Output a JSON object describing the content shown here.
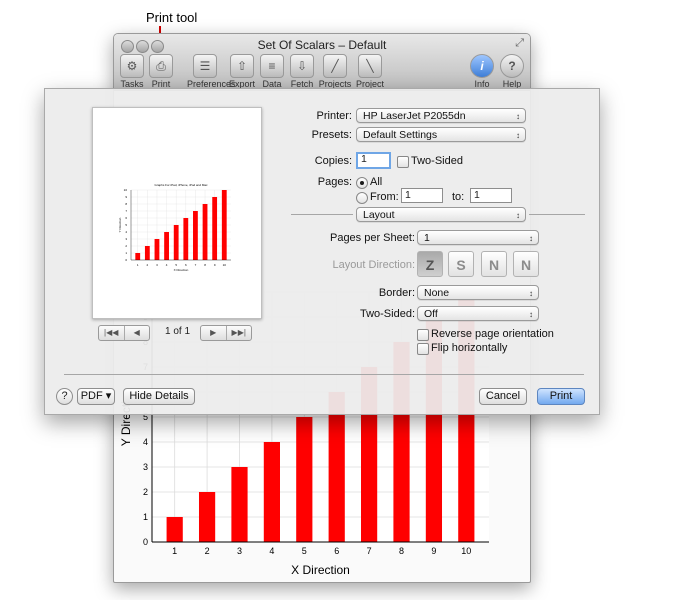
{
  "callout": {
    "label": "Print tool"
  },
  "window": {
    "title": "Set Of Scalars – Default",
    "toolbar": [
      {
        "label": "Tasks",
        "icon": "gear-icon",
        "glyph": "⚙"
      },
      {
        "label": "Print",
        "icon": "printer-icon",
        "glyph": "⎙"
      },
      {
        "label": "Preferences",
        "icon": "preferences-icon",
        "glyph": "☰"
      },
      {
        "label": "Export",
        "icon": "export-icon",
        "glyph": "⇧"
      },
      {
        "label": "Data",
        "icon": "data-icon",
        "glyph": "≡"
      },
      {
        "label": "Fetch",
        "icon": "fetch-icon",
        "glyph": "⇩"
      },
      {
        "label": "Projects",
        "icon": "projects-icon",
        "glyph": "╱"
      },
      {
        "label": "Project",
        "icon": "project-icon",
        "glyph": "╲"
      },
      {
        "label": "Info",
        "icon": "info-icon",
        "glyph": "i"
      },
      {
        "label": "Help",
        "icon": "help-icon",
        "glyph": "?"
      }
    ]
  },
  "print_dialog": {
    "printer_label": "Printer:",
    "printer_value": "HP LaserJet P2055dn",
    "presets_label": "Presets:",
    "presets_value": "Default Settings",
    "copies_label": "Copies:",
    "copies_value": "1",
    "two_sided_checkbox_label": "Two-Sided",
    "pages_label": "Pages:",
    "pages_all_label": "All",
    "pages_from_label": "From:",
    "pages_from_value": "1",
    "pages_to_label": "to:",
    "pages_to_value": "1",
    "section_value": "Layout",
    "pages_per_sheet_label": "Pages per Sheet:",
    "pages_per_sheet_value": "1",
    "layout_direction_label": "Layout Direction:",
    "layout_direction_glyphs": [
      "Z",
      "S",
      "N",
      "N"
    ],
    "border_label": "Border:",
    "border_value": "None",
    "two_sided_label": "Two-Sided:",
    "two_sided_value": "Off",
    "reverse_label": "Reverse page orientation",
    "flip_label": "Flip horizontally",
    "page_count": "1 of 1",
    "nav_first": "|◀◀",
    "nav_prev": "◀",
    "nav_next": "▶",
    "nav_last": "▶▶|",
    "help_button": "?",
    "pdf_button": "PDF ▾",
    "hide_details_button": "Hide Details",
    "cancel_button": "Cancel",
    "print_button": "Print"
  },
  "chart_data": [
    {
      "type": "bar",
      "title": "",
      "xlabel": "X Direction",
      "ylabel": "Y Direction",
      "categories": [
        "1",
        "2",
        "3",
        "4",
        "5",
        "6",
        "7",
        "8",
        "9",
        "10"
      ],
      "values": [
        1,
        2,
        3,
        4,
        5,
        6,
        7,
        8,
        9,
        10
      ],
      "ylim": [
        0,
        10
      ],
      "grid": true,
      "bar_color": "#ff0000"
    },
    {
      "type": "bar",
      "title": "Graphs For iPad, iPhone, iPod and Mac",
      "xlabel": "X Direction",
      "ylabel": "Y Direction",
      "categories": [
        "1",
        "2",
        "3",
        "4",
        "5",
        "6",
        "7",
        "8",
        "9",
        "10"
      ],
      "values": [
        1,
        2,
        3,
        4,
        5,
        6,
        7,
        8,
        9,
        10
      ],
      "ylim": [
        0,
        10
      ],
      "grid": true,
      "bar_color": "#ff0000"
    }
  ]
}
